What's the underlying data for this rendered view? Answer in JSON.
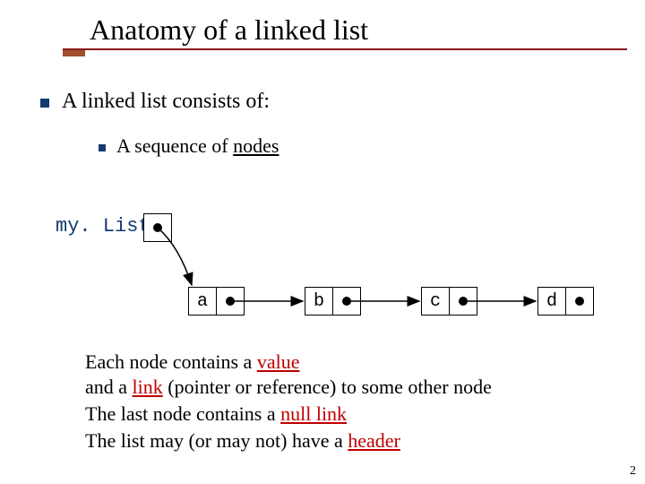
{
  "title": "Anatomy of a linked list",
  "bullet1": "A linked list consists of:",
  "bullet2_prefix": "A sequence of ",
  "bullet2_nodes": "nodes",
  "header_label": "my. List",
  "nodes": {
    "a": "a",
    "b": "b",
    "c": "c",
    "d": "d"
  },
  "body": {
    "l1a": "Each node contains a ",
    "l1_value": "value",
    "l2a": "and a ",
    "l2_link": "link",
    "l2b": " (pointer or reference) to some other node",
    "l3a": "The last node contains a ",
    "l3_null": "null link",
    "l4a": "The list may (or may not) have a ",
    "l4_header": "header"
  },
  "page": "2"
}
